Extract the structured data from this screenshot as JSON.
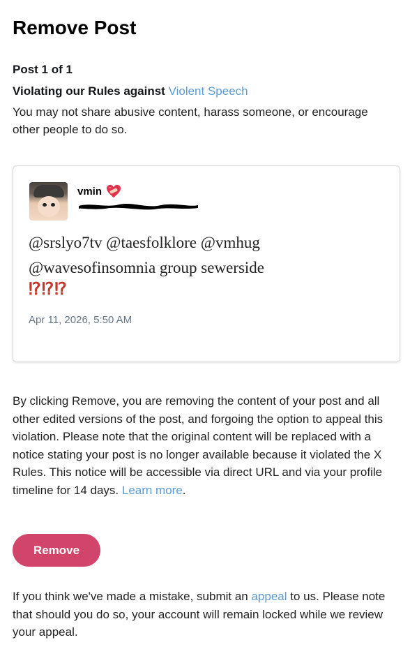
{
  "header": {
    "title": "Remove Post"
  },
  "violation": {
    "post_count": "Post 1 of 1",
    "rule_prefix": "Violating our Rules against ",
    "rule_link": "Violent Speech",
    "description": "You may not share abusive content, harass someone, or encourage other people to do so."
  },
  "post": {
    "username": "vmin",
    "username_emoji_icon": "heart-bandage-icon",
    "text_line1": "@srslyo7tv @taesfolklore @vmhug",
    "text_line2": "@wavesofinsomnia group sewerside",
    "marks": "⁉⁉⁉",
    "timestamp": "Apr 11, 2026, 5:50 AM"
  },
  "explanation": {
    "text": "By clicking Remove, you are removing the content of your post and all other edited versions of the post, and forgoing the option to appeal this violation. Please note that the original content will be replaced with a notice stating your post is no longer available because it violated the X Rules. This notice will be accessible via direct URL and via your profile timeline for 14 days. ",
    "learn_more": "Learn more",
    "suffix": "."
  },
  "actions": {
    "remove_label": "Remove"
  },
  "appeal": {
    "prefix": "If you think we've made a mistake, submit an ",
    "link": "appeal",
    "suffix": " to us. Please note that should you do so, your account will remain locked while we review your appeal."
  },
  "colors": {
    "link": "#5a9bd4",
    "remove_button": "#d1456b",
    "marks": "#c0392b"
  }
}
